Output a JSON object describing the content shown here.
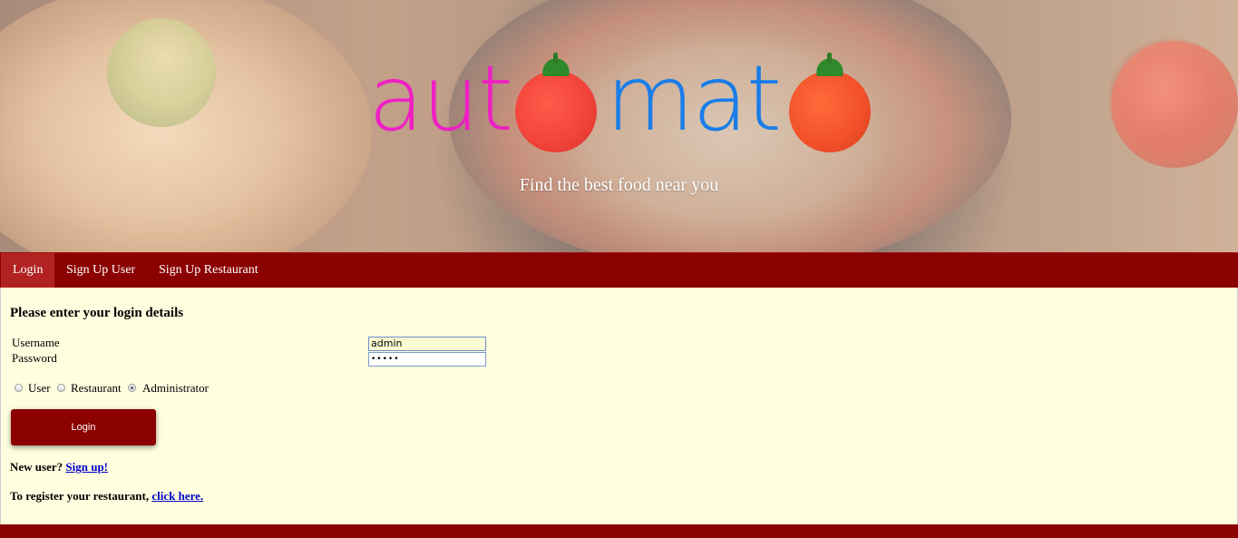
{
  "brand": {
    "logo_part1": "aut",
    "logo_part2": "mat",
    "tagline": "Find the best food near you"
  },
  "nav": {
    "items": [
      {
        "label": "Login",
        "active": true
      },
      {
        "label": "Sign Up User",
        "active": false
      },
      {
        "label": "Sign Up Restaurant",
        "active": false
      }
    ]
  },
  "form": {
    "heading": "Please enter your login details",
    "username_label": "Username",
    "username_value": "admin",
    "password_label": "Password",
    "password_value": "•••••",
    "roles": [
      {
        "label": "User",
        "checked": false
      },
      {
        "label": "Restaurant",
        "checked": false
      },
      {
        "label": "Administrator",
        "checked": true
      }
    ],
    "submit_label": "Login"
  },
  "links": {
    "new_user_text": "New user?",
    "new_user_link": "Sign up!",
    "register_text": "To register your restaurant,",
    "register_link": "click here."
  },
  "colors": {
    "nav_bg": "#8b0000",
    "nav_active": "#b22222",
    "panel_bg": "#ffffdf",
    "logo_pink": "#ee20c4",
    "logo_blue": "#1a7de8",
    "link": "#0000cc"
  }
}
